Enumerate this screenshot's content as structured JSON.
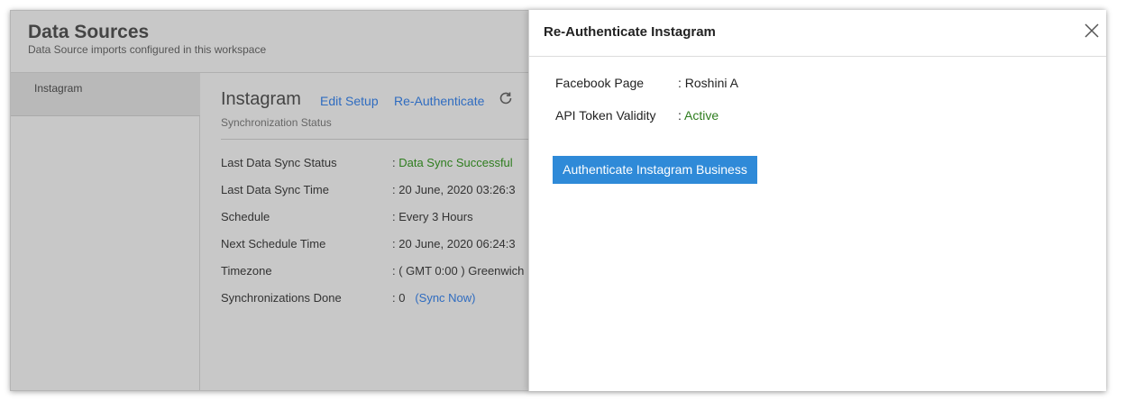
{
  "header": {
    "title": "Data Sources",
    "subtitle": "Data Source imports configured in this workspace"
  },
  "sidebar": {
    "items": [
      {
        "label": "Instagram"
      }
    ]
  },
  "main": {
    "title": "Instagram",
    "edit_setup": "Edit Setup",
    "reauthenticate": "Re-Authenticate",
    "refresh_icon": "refresh-icon",
    "sync_status_label": "Synchronization Status",
    "details": [
      {
        "key": "Last Data Sync Status",
        "value": ": ",
        "value_highlight": "Data Sync Successful"
      },
      {
        "key": "Last Data Sync Time",
        "value": ": 20 June, 2020 03:26:3"
      },
      {
        "key": "Schedule",
        "value": ": Every 3 Hours"
      },
      {
        "key": "Next Schedule Time",
        "value": ": 20 June, 2020 06:24:3"
      },
      {
        "key": "Timezone",
        "value": ": ( GMT 0:00 ) Greenwich"
      },
      {
        "key": "Synchronizations Done",
        "value": ": 0",
        "link": "(Sync Now)"
      }
    ]
  },
  "modal": {
    "title": "Re-Authenticate Instagram",
    "close_icon": "close-icon",
    "fields": [
      {
        "key": "Facebook Page",
        "value": ": Roshini A"
      },
      {
        "key": "API Token Validity",
        "value": ": ",
        "value_highlight": "Active"
      }
    ],
    "auth_button": "Authenticate Instagram Business"
  },
  "colors": {
    "link": "#2f6cc0",
    "success": "#2e7d1e",
    "button": "#2f8ad8",
    "overlay": "#c8c8c8"
  }
}
